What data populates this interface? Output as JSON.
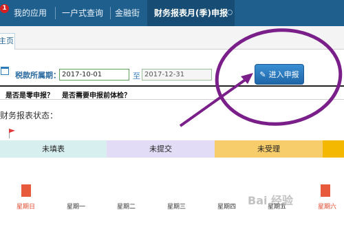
{
  "topbar": {
    "badge": "1",
    "items": [
      {
        "label": "我的应用"
      },
      {
        "label": "一户式查询"
      },
      {
        "label": "金融街"
      },
      {
        "label": "财务报表月(季)申报"
      }
    ]
  },
  "subtab": {
    "label": "主页"
  },
  "period": {
    "label": "税款所属期：",
    "start": "2017-10-01",
    "to": "至",
    "end": "2017-12-31"
  },
  "enter_button": {
    "label": "进入申报"
  },
  "questions": [
    "是否是零申报？",
    "是否需要申报前体检？"
  ],
  "status_title": "财务报表状态：",
  "status_bars": [
    {
      "label": "未填表",
      "color": "#d8efef"
    },
    {
      "label": "未提交",
      "color": "#e3dcf7"
    },
    {
      "label": "未受理",
      "color": "#f7cc6a"
    },
    {
      "label": "",
      "color": "#f5b800"
    }
  ],
  "days": [
    "星期日",
    "星期一",
    "星期二",
    "星期三",
    "星期四",
    "星期五",
    "星期六"
  ],
  "watermark": "Bai 经验",
  "colors": {
    "accent": "#1f5f8e",
    "annotation": "#7a1f8a",
    "weekend": "#e2452c"
  }
}
